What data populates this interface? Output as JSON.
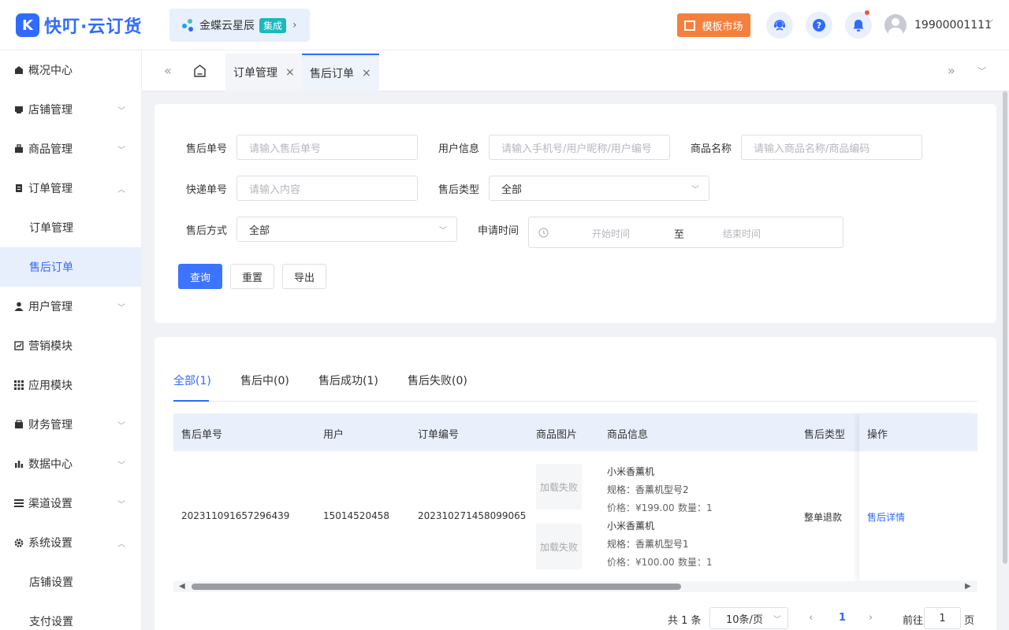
{
  "app": {
    "logo_letter": "K",
    "name": "快叮·云订货"
  },
  "header": {
    "kingdee": {
      "name": "金蝶云星辰",
      "tag": "集成",
      "arrow": "›"
    },
    "market_button": "模板市场",
    "user_phone": "19900001111"
  },
  "sidebar": {
    "items": [
      {
        "label": "概况中心",
        "icon": "dashboard-icon"
      },
      {
        "label": "店铺管理",
        "icon": "store-icon",
        "expand": "collapsed"
      },
      {
        "label": "商品管理",
        "icon": "goods-icon",
        "expand": "collapsed"
      },
      {
        "label": "订单管理",
        "icon": "order-icon",
        "expand": "expanded"
      },
      {
        "label": "订单管理",
        "sub": true
      },
      {
        "label": "售后订单",
        "sub": true,
        "active": true
      },
      {
        "label": "用户管理",
        "icon": "user-icon",
        "expand": "collapsed"
      },
      {
        "label": "营销模块",
        "icon": "marketing-icon"
      },
      {
        "label": "应用模块",
        "icon": "apps-icon"
      },
      {
        "label": "财务管理",
        "icon": "finance-icon",
        "expand": "collapsed"
      },
      {
        "label": "数据中心",
        "icon": "data-icon",
        "expand": "collapsed"
      },
      {
        "label": "渠道设置",
        "icon": "channel-icon",
        "expand": "collapsed"
      },
      {
        "label": "系统设置",
        "icon": "settings-icon",
        "expand": "expanded"
      },
      {
        "label": "店铺设置",
        "sub": true
      },
      {
        "label": "支付设置",
        "sub": true
      }
    ]
  },
  "tabs": [
    {
      "label": "订单管理",
      "active": false
    },
    {
      "label": "售后订单",
      "active": true
    }
  ],
  "filters": {
    "aftersale_no": {
      "label": "售后单号",
      "placeholder": "请输入售后单号"
    },
    "user_info": {
      "label": "用户信息",
      "placeholder": "请输入手机号/用户昵称/用户编号"
    },
    "product_name": {
      "label": "商品名称",
      "placeholder": "请输入商品名称/商品编码"
    },
    "express_no": {
      "label": "快递单号",
      "placeholder": "请输入内容"
    },
    "aftersale_type": {
      "label": "售后类型",
      "value": "全部"
    },
    "aftersale_method": {
      "label": "售后方式",
      "value": "全部"
    },
    "apply_time": {
      "label": "申请时间",
      "start": "开始时间",
      "separator": "至",
      "end": "结束时间"
    },
    "buttons": {
      "search": "查询",
      "reset": "重置",
      "export": "导出"
    }
  },
  "order_tabs": [
    "全部(1)",
    "售后中(0)",
    "售后成功(1)",
    "售后失败(0)"
  ],
  "table": {
    "columns": [
      "售后单号",
      "用户",
      "订单编号",
      "商品图片",
      "商品信息",
      "售后类型",
      "操作"
    ],
    "rows": [
      {
        "aftersale_no": "202311091657296439",
        "user": "15014520458",
        "order_no": "202310271458099065",
        "image_fallback": "加载失败",
        "goods": [
          {
            "name": "小米香薰机",
            "spec": "规格：香薰机型号2",
            "price": "价格：¥199.00",
            "qty": "数量：1"
          },
          {
            "name": "小米香薰机",
            "spec": "规格：香薰机型号1",
            "price": "价格：¥100.00",
            "qty": "数量：1"
          }
        ],
        "type": "整单退款",
        "action": "售后详情"
      }
    ]
  },
  "pagination": {
    "total": "共 1 条",
    "page_size": "10条/页",
    "current": "1",
    "goto": "前往",
    "goto_value": "1",
    "page_unit": "页"
  },
  "colors": {
    "primary": "#2f6bff",
    "orange": "#f5803e",
    "teal": "#19b9bd"
  }
}
